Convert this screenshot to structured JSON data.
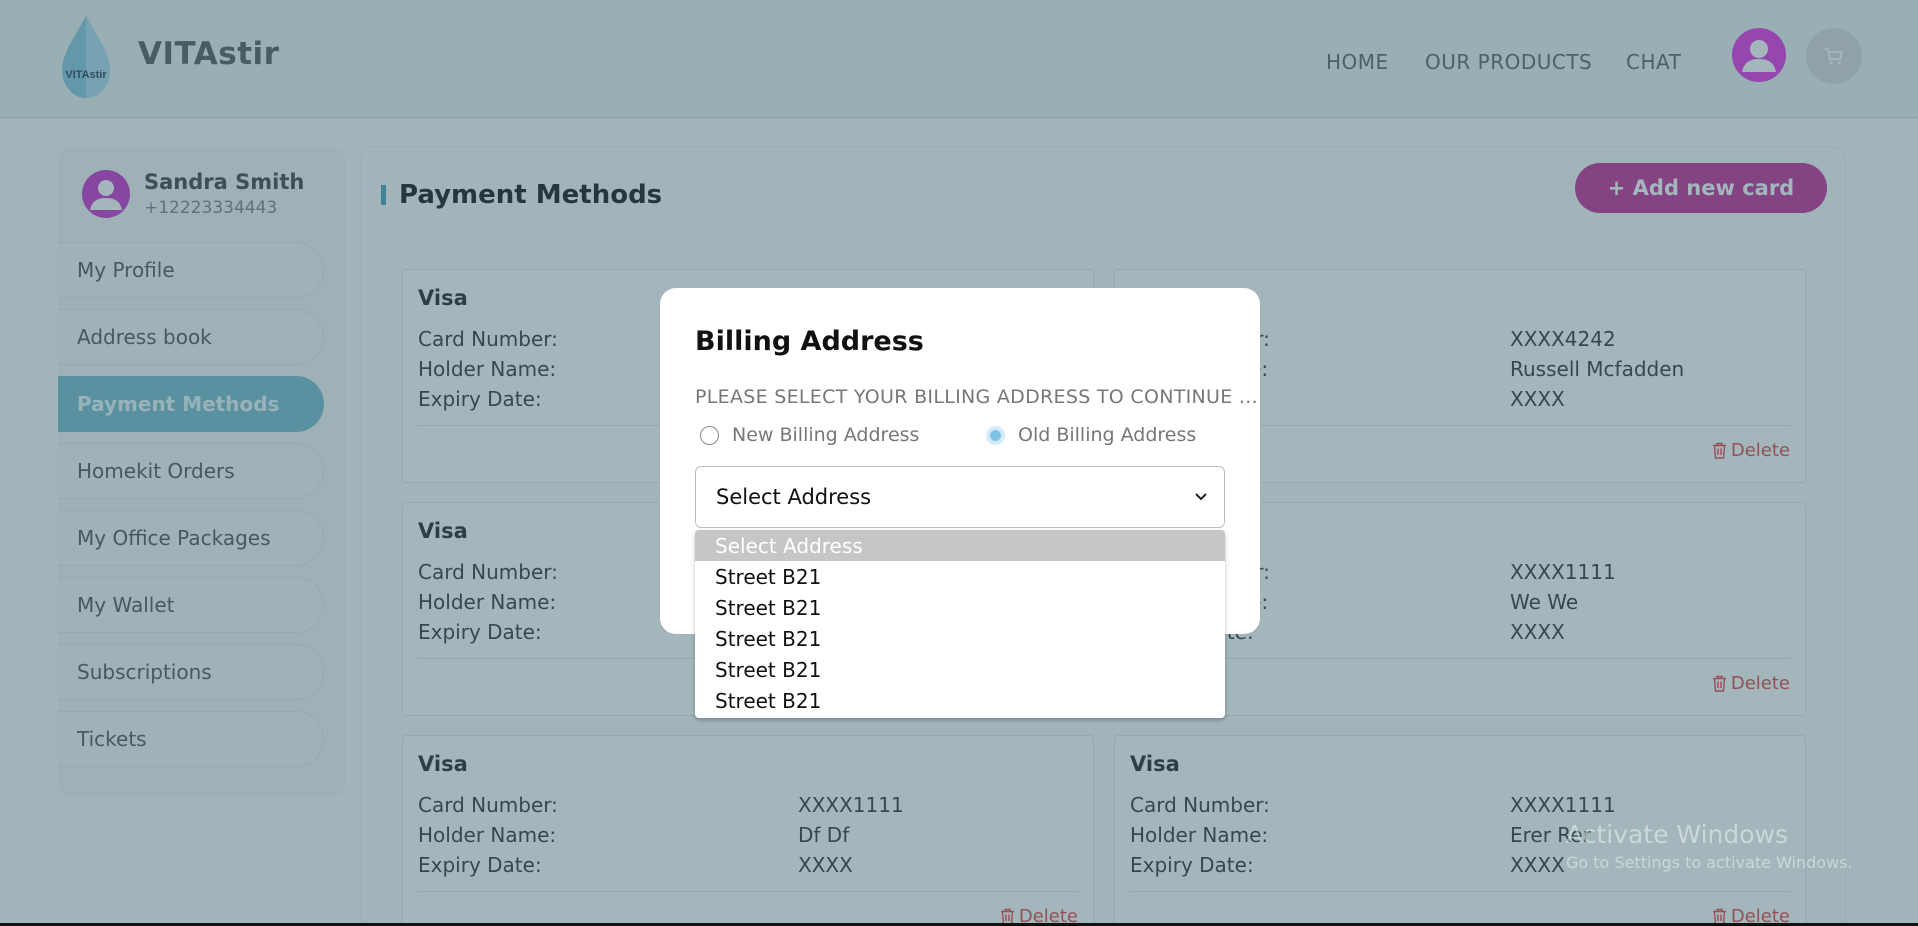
{
  "header": {
    "brand": "VITAstir",
    "logo_text": "VITAstir",
    "nav": {
      "home": "HOME",
      "products": "OUR PRODUCTS",
      "chat": "CHAT"
    }
  },
  "sidebar": {
    "user": {
      "name": "Sandra Smith",
      "phone": "+12223334443"
    },
    "items": [
      {
        "label": "My Profile"
      },
      {
        "label": "Address book"
      },
      {
        "label": "Payment Methods",
        "active": true
      },
      {
        "label": "Homekit Orders"
      },
      {
        "label": "My Office Packages"
      },
      {
        "label": "My Wallet"
      },
      {
        "label": "Subscriptions"
      },
      {
        "label": "Tickets"
      }
    ]
  },
  "main": {
    "title": "Payment Methods",
    "add_card_label": "+ Add new card",
    "labels": {
      "card_number": "Card Number:",
      "holder_name": "Holder Name:",
      "expiry_date": "Expiry Date:",
      "delete": "Delete"
    },
    "cards": [
      {
        "brand": "Visa",
        "card_number": "",
        "holder_name": "",
        "expiry_date": ""
      },
      {
        "brand": "",
        "card_number": "XXXX4242",
        "holder_name": "Russell Mcfadden",
        "expiry_date": "XXXX"
      },
      {
        "brand": "Visa",
        "card_number": "",
        "holder_name": "",
        "expiry_date": ""
      },
      {
        "brand": "",
        "card_number": "XXXX1111",
        "holder_name": "We We",
        "expiry_date": "XXXX"
      },
      {
        "brand": "Visa",
        "card_number": "XXXX1111",
        "holder_name": "Df Df",
        "expiry_date": "XXXX"
      },
      {
        "brand": "Visa",
        "card_number": "XXXX1111",
        "holder_name": "Erer Rer",
        "expiry_date": "XXXX"
      }
    ]
  },
  "modal": {
    "title": "Billing Address",
    "prompt": "PLEASE SELECT YOUR BILLING ADDRESS TO CONTINUE ...",
    "radio_new": "New Billing Address",
    "radio_old": "Old Billing Address",
    "selected_radio": "old",
    "select_value": "Select Address",
    "options": [
      "Select Address",
      "Street B21",
      "Street B21",
      "Street B21",
      "Street B21",
      "Street B21"
    ]
  },
  "watermark": {
    "line1": "Activate Windows",
    "line2": "Go to Settings to activate Windows."
  },
  "colors": {
    "brand_magenta": "#c2188f",
    "active_teal": "#6fb5c8",
    "delete_red": "#e03434",
    "avatar_magenta": "#e61ee6"
  }
}
